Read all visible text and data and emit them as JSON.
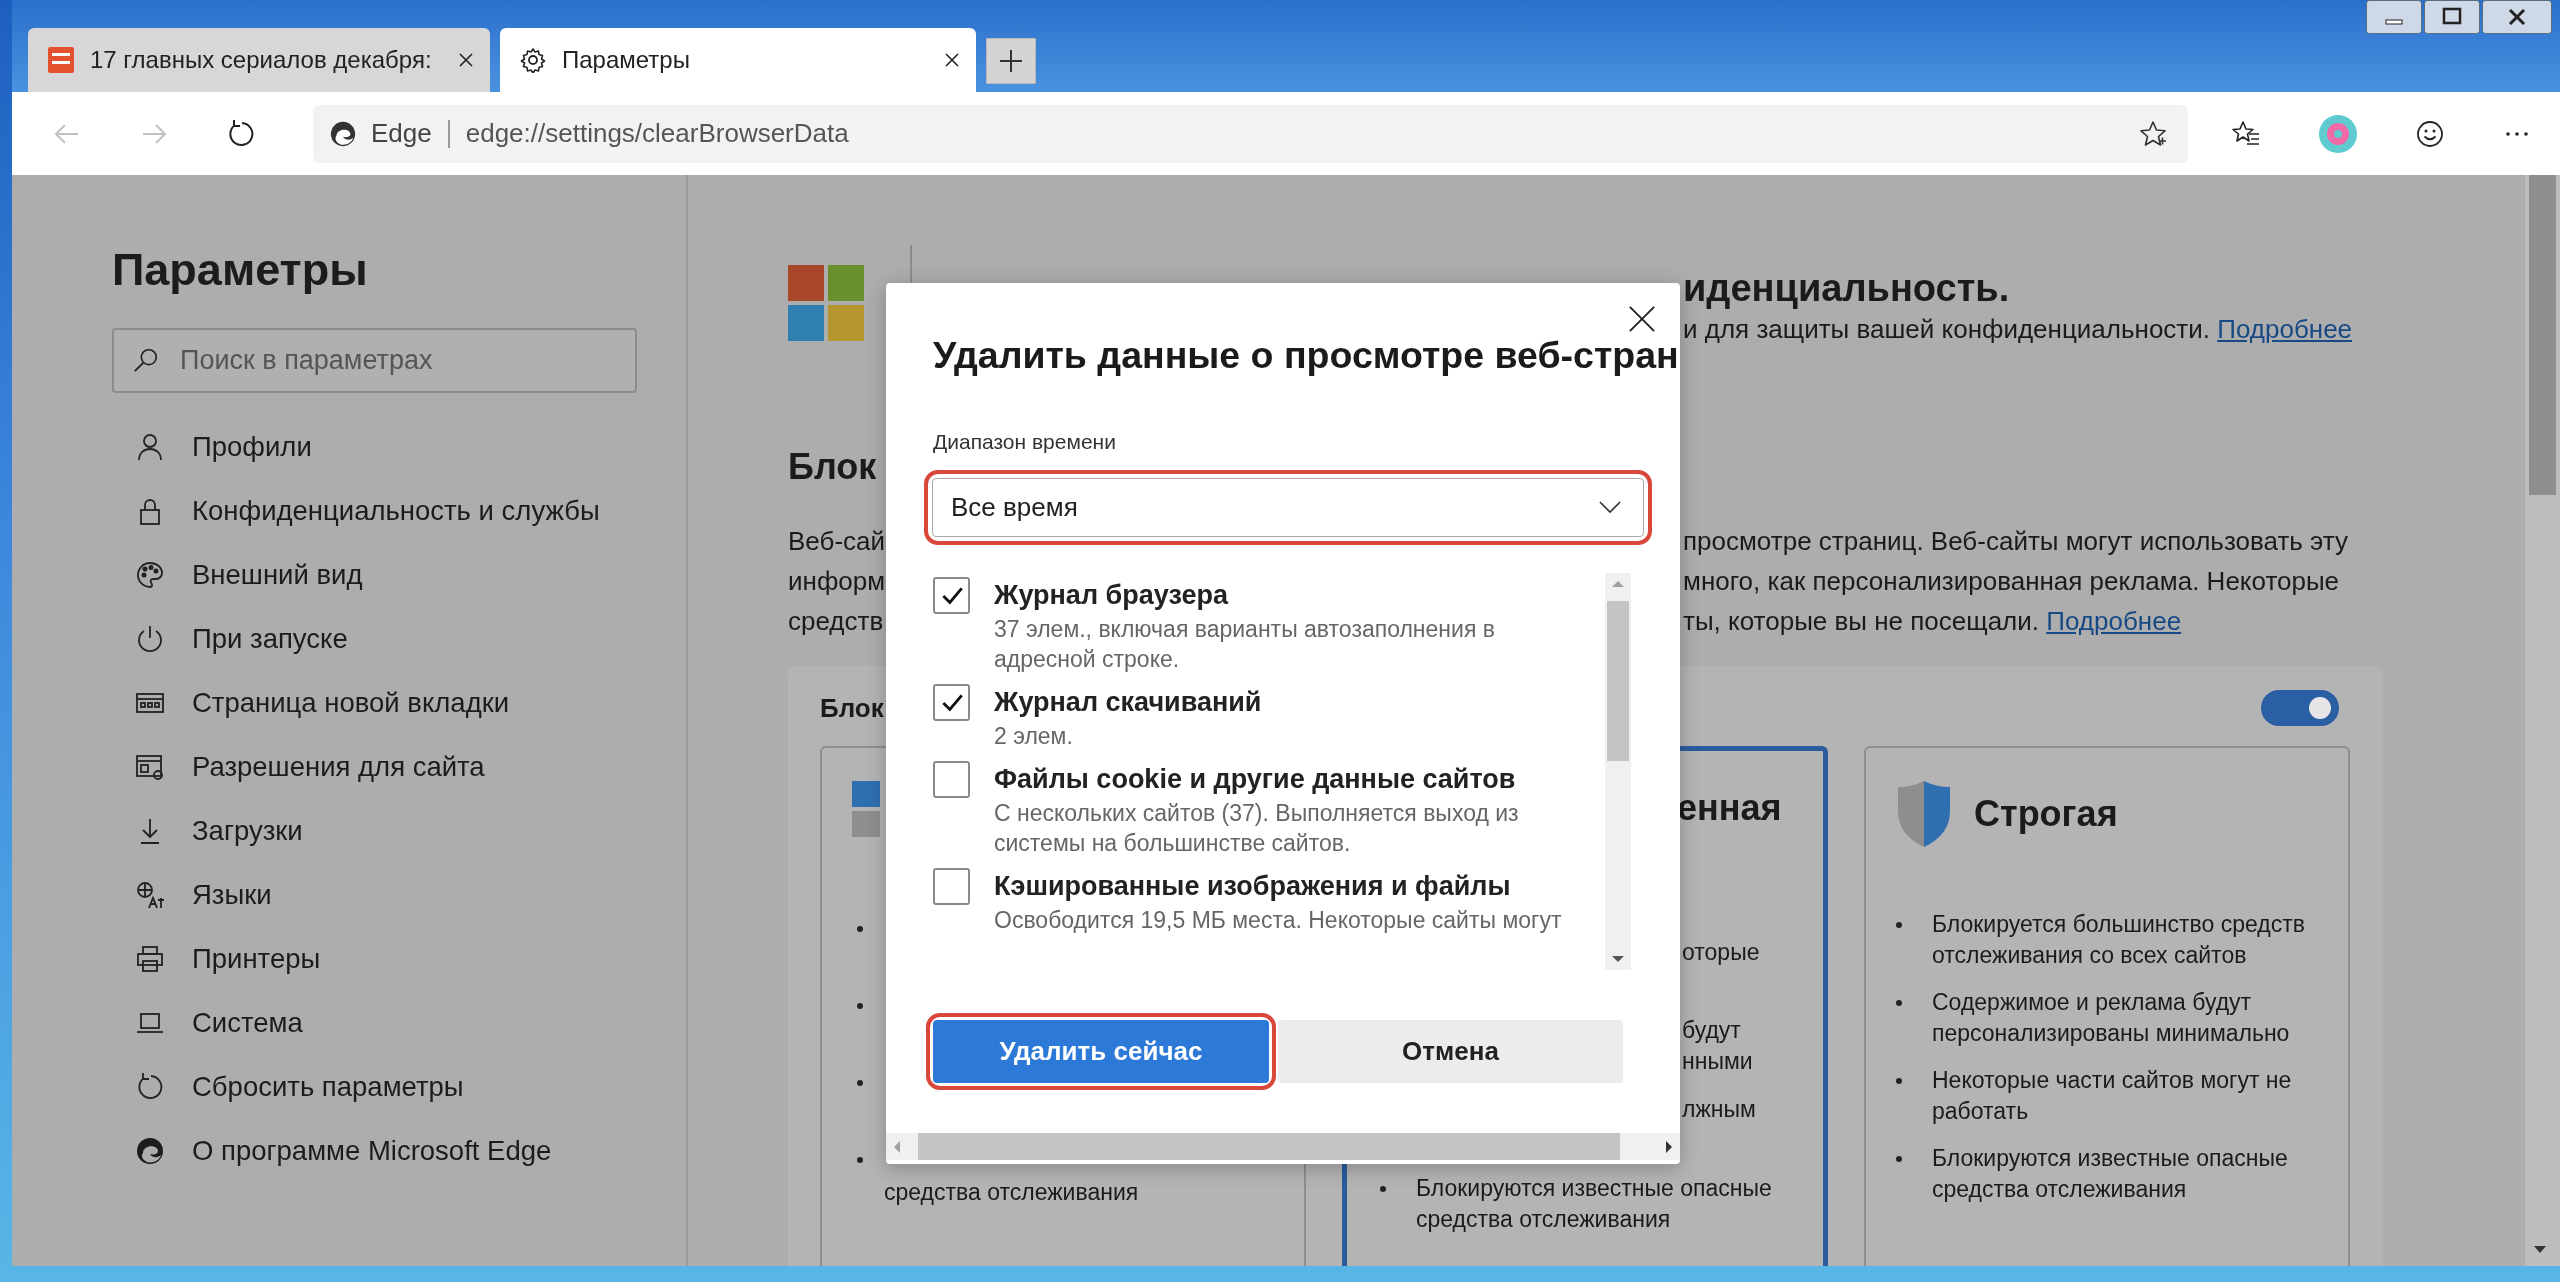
{
  "tabs": [
    {
      "title": "17 главных сериалов декабря:",
      "selected": false,
      "kind": "site"
    },
    {
      "title": "Параметры",
      "selected": true,
      "kind": "settings"
    }
  ],
  "nav": [
    {
      "kind": "back",
      "disabled": true
    },
    {
      "kind": "forward",
      "disabled": true
    },
    {
      "kind": "refresh",
      "disabled": false
    }
  ],
  "address": {
    "site_label": "Edge",
    "url": "edge://settings/clearBrowserData"
  },
  "sidebar": {
    "title": "Параметры",
    "search": {
      "placeholder": "Поиск в параметрах"
    },
    "items": [
      {
        "label": "Профили"
      },
      {
        "label": "Конфиденциальность и службы"
      },
      {
        "label": "Внешний вид"
      },
      {
        "label": "При запуске"
      },
      {
        "label": "Страница новой вкладки"
      },
      {
        "label": "Разрешения для сайта"
      },
      {
        "label": "Загрузки"
      },
      {
        "label": "Языки"
      },
      {
        "label": "Принтеры"
      },
      {
        "label": "Система"
      },
      {
        "label": "Сбросить параметры"
      },
      {
        "label": "О программе Microsoft Edge"
      }
    ]
  },
  "page": {
    "heading_end": "иденциальность.",
    "subtitle": "и для защиты вашей конфиденциальности.",
    "subtitle_link": "Подробнее",
    "section_title": "Блок",
    "paragraph_left": [
      "Веб-сай",
      "информ",
      "средств"
    ],
    "paragraph_right": [
      "просмотре страниц. Веб-сайты могут использовать эту",
      "много, как персонализированная реклама. Некоторые",
      "ты, которые вы не посещали."
    ],
    "paragraph_link": "Подробнее",
    "card": {
      "title": "Блок",
      "toggle_on": true,
      "options": [
        {
          "kind": "hidden",
          "selected": false,
          "tail": "средства отслеживания"
        },
        {
          "kind": "partial",
          "selected": true,
          "title": "енная",
          "fragments": [
            "оторые",
            "будут",
            "нными",
            "лжным"
          ],
          "bullets": [
            "Блокируются известные опасные средства отслеживания"
          ]
        },
        {
          "kind": "full",
          "selected": false,
          "title": "Строгая",
          "bullets": [
            "Блокируется большинство средств отслеживания со всех сайтов",
            "Содержимое и реклама будут персонализированы минимально",
            "Некоторые части сайтов могут не работать",
            "Блокируются известные опасные средства отслеживания"
          ]
        }
      ]
    }
  },
  "dialog": {
    "title": "Удалить данные о просмотре веб-стран",
    "range_label": "Диапазон времени",
    "range_value": "Все время",
    "range_highlighted": true,
    "items": [
      {
        "title": "Журнал браузера",
        "description": "37 элем., включая варианты автозаполнения в адресной строке.",
        "checked": true
      },
      {
        "title": "Журнал скачиваний",
        "description": "2 элем.",
        "checked": true
      },
      {
        "title": "Файлы cookie и другие данные сайтов",
        "description": "С нескольких сайтов (37). Выполняется выход из системы на большинстве сайтов.",
        "checked": false
      },
      {
        "title": "Кэшированные изображения и файлы",
        "description": "Освободится 19,5 МБ места. Некоторые сайты могут",
        "checked": false
      }
    ],
    "buttons": [
      {
        "label": "Удалить сейчас",
        "kind": "primary",
        "highlighted": true
      },
      {
        "label": "Отмена",
        "kind": "secondary",
        "highlighted": false
      }
    ]
  }
}
